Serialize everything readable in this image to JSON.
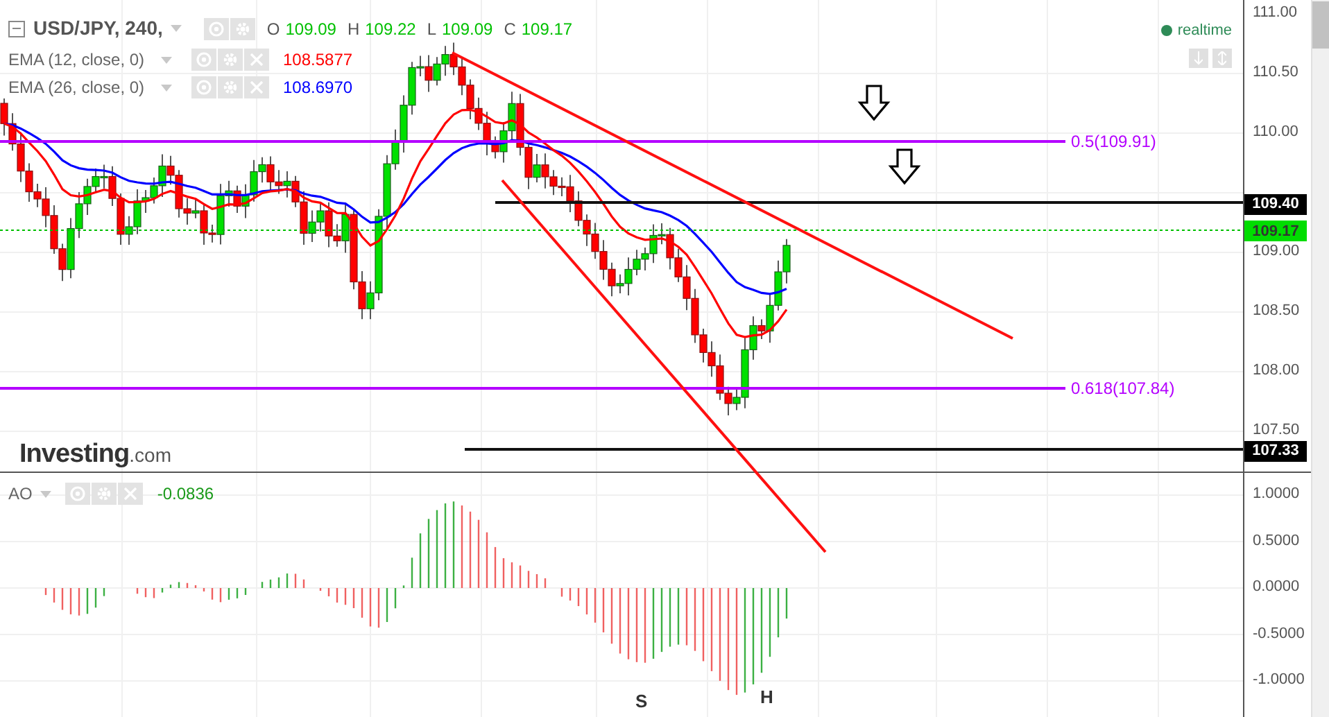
{
  "header": {
    "symbol": "USD/JPY, 240,",
    "ohlc": [
      {
        "label": "O",
        "value": "109.09"
      },
      {
        "label": "H",
        "value": "109.22"
      },
      {
        "label": "L",
        "value": "109.09"
      },
      {
        "label": "C",
        "value": "109.17"
      }
    ]
  },
  "indicators": [
    {
      "name": "EMA (12, close, 0)",
      "value": "108.5877",
      "color": "#ff0000"
    },
    {
      "name": "EMA (26, close, 0)",
      "value": "108.6970",
      "color": "#0000ff"
    }
  ],
  "status": {
    "label": "realtime"
  },
  "fib_levels": [
    {
      "label": "0.5(109.91)"
    },
    {
      "label": "0.618(107.84)"
    }
  ],
  "logo": {
    "name": "Investing",
    "suffix": ".com"
  },
  "price_axis": {
    "ticks": [
      "111.00",
      "110.50",
      "110.00",
      "109.00",
      "108.50",
      "108.00",
      "107.50"
    ],
    "tags": [
      {
        "value": "109.40",
        "kind": "level"
      },
      {
        "value": "109.17",
        "kind": "last"
      },
      {
        "value": "107.33",
        "kind": "level"
      }
    ]
  },
  "oscillator": {
    "name": "AO",
    "value": "-0.0836",
    "ticks": [
      "1.0000",
      "0.5000",
      "0.0000",
      "-0.5000",
      "-1.0000"
    ],
    "markers": [
      {
        "label": "S"
      },
      {
        "label": "H"
      }
    ]
  }
}
